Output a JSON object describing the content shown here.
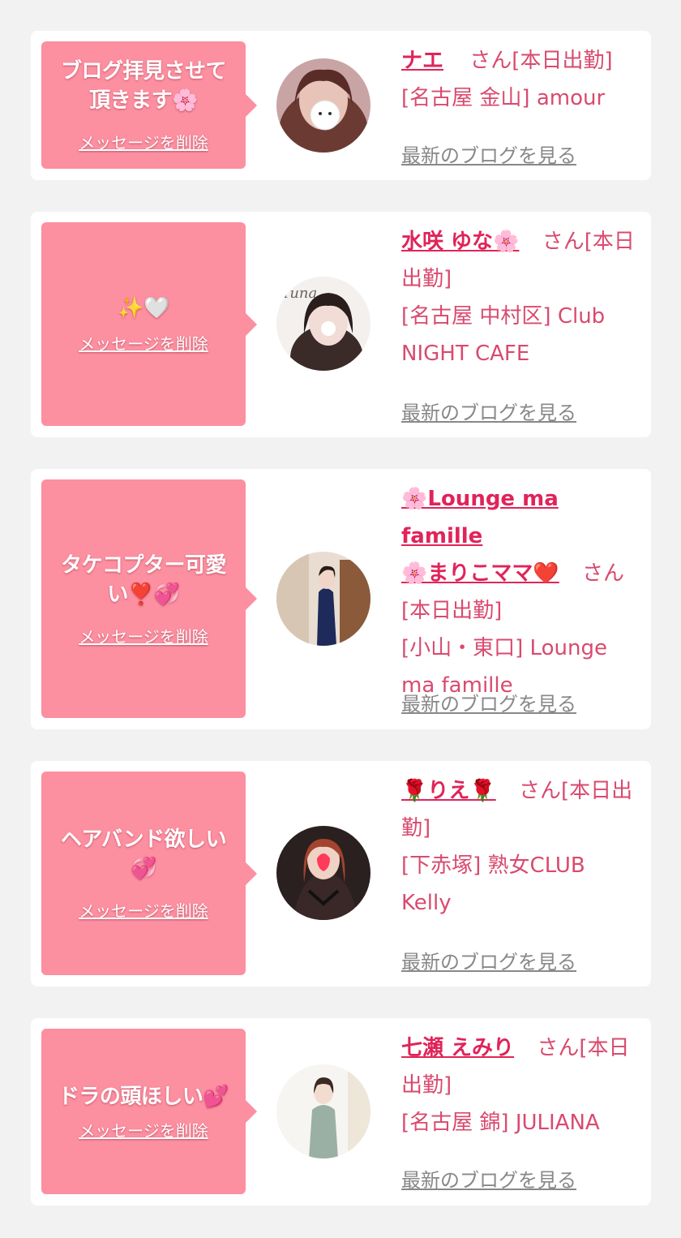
{
  "delete_label": "メッセージを削除",
  "blog_label": "最新のブログを見る",
  "san_suffix": "さん",
  "colors": {
    "bubble": "#fc8fa0",
    "name": "#e0245a",
    "text": "#d94a6e",
    "link_gray": "#888888",
    "background": "#f2f2f2"
  },
  "cards": [
    {
      "message_line1": "ブログ拝見させて",
      "message_line2": "頂きます🌸",
      "name": "ナエ",
      "status": "[本日出勤]",
      "shop": "[名古屋 金山] amour"
    },
    {
      "message_line1": "✨🤍",
      "message_line2": "",
      "name": "水咲 ゆな🌸",
      "status": "[本日出勤]",
      "shop_line1": "[名古屋 中村区] Club",
      "shop_line2": "NIGHT CAFE"
    },
    {
      "message_line1": "タケコプター可愛",
      "message_line2": "い❣️💞",
      "name_line1": "🌸Lounge ma famille",
      "name_line2": "🌸まりこママ❤️",
      "status": "[本日出勤]",
      "shop_line1": "[小山・東口] Lounge",
      "shop_line2": "ma famille"
    },
    {
      "message_line1": "ヘアバンド欲しい",
      "message_line2": "💞",
      "name": "🌹りえ🌹",
      "status": "[本日出勤]",
      "shop_line1": "[下赤塚] 熟女CLUB",
      "shop_line2": "Kelly"
    },
    {
      "message_line1": "ドラの頭ほしい💕",
      "message_line2": "",
      "name": "七瀬 えみり",
      "status": "[本日出勤]",
      "shop": "[名古屋 錦] JULIANA"
    }
  ]
}
